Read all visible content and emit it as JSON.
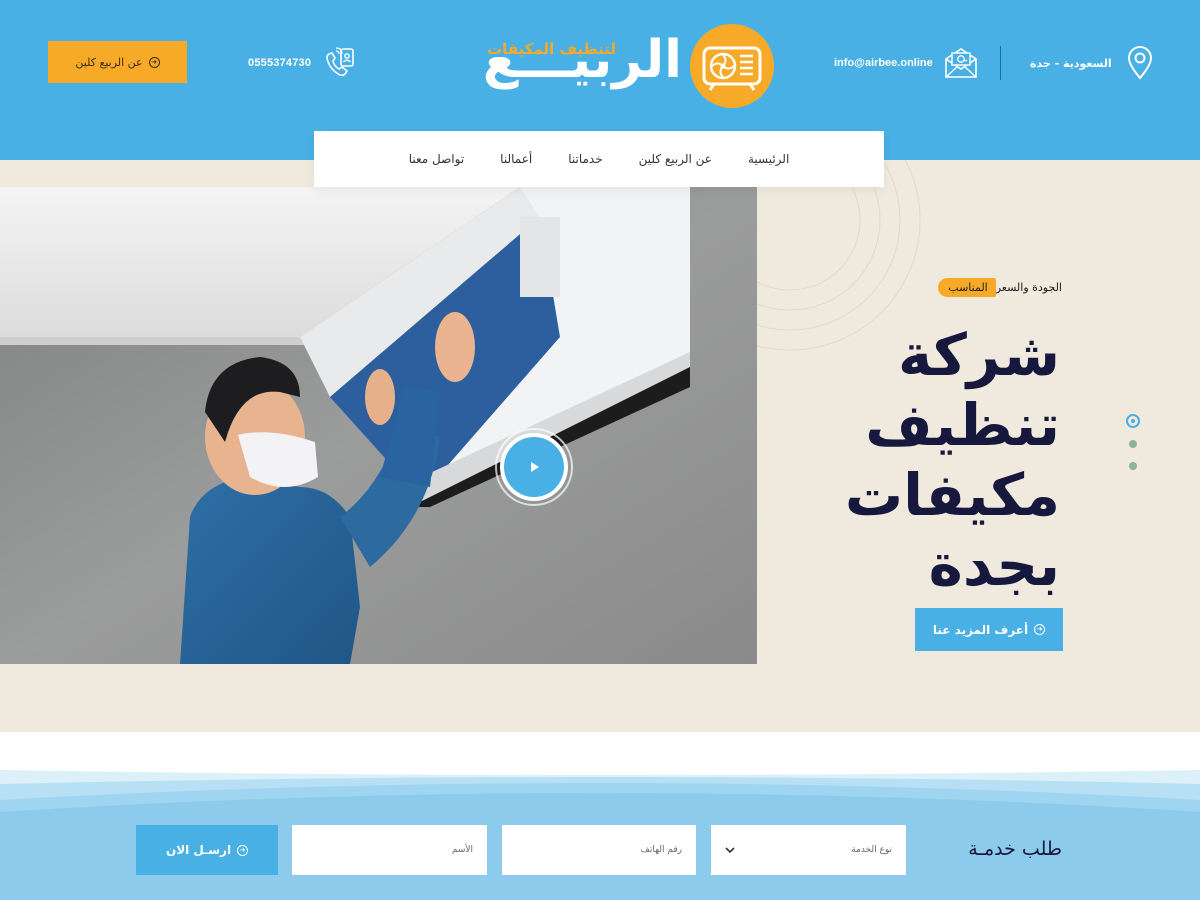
{
  "header": {
    "about_button": "عن الربيع كلين",
    "phone": "0555374730",
    "logo_main": "الربيـــع",
    "logo_sub": "لتنظيف المكيفات",
    "email": "info@airbee.online",
    "location": "السعودية - جدة"
  },
  "nav": {
    "items": [
      "الرئيسية",
      "عن الربيع كلين",
      "خدماتنا",
      "أعمالنا",
      "تواصل معنا"
    ]
  },
  "hero": {
    "tag_text": "الجودة والسعر",
    "tag_highlight": "المناسب",
    "headline_lines": [
      "شركة",
      "تنظيف",
      "مكيفات",
      "بجدة"
    ],
    "more_button": "أعرف المزيد عنا",
    "slider_count": 3,
    "active_slide": 1
  },
  "request_form": {
    "title": "طلب خدمـة",
    "service_type_placeholder": "نوع الخدمة",
    "phone_placeholder": "رقم الهاتف",
    "name_placeholder": "الأسم",
    "send_button": "ارسـل الان"
  },
  "icons": {
    "about_arrow": "circle-arrow-icon",
    "phone": "phone-icon",
    "email": "envelope-icon",
    "location": "location-pin-icon",
    "play": "play-icon",
    "select": "chevron-down-icon"
  },
  "colors": {
    "primary": "#48b0e4",
    "accent": "#f7aa28",
    "hero_bg": "#f0e9dd",
    "headline": "#17183d"
  }
}
